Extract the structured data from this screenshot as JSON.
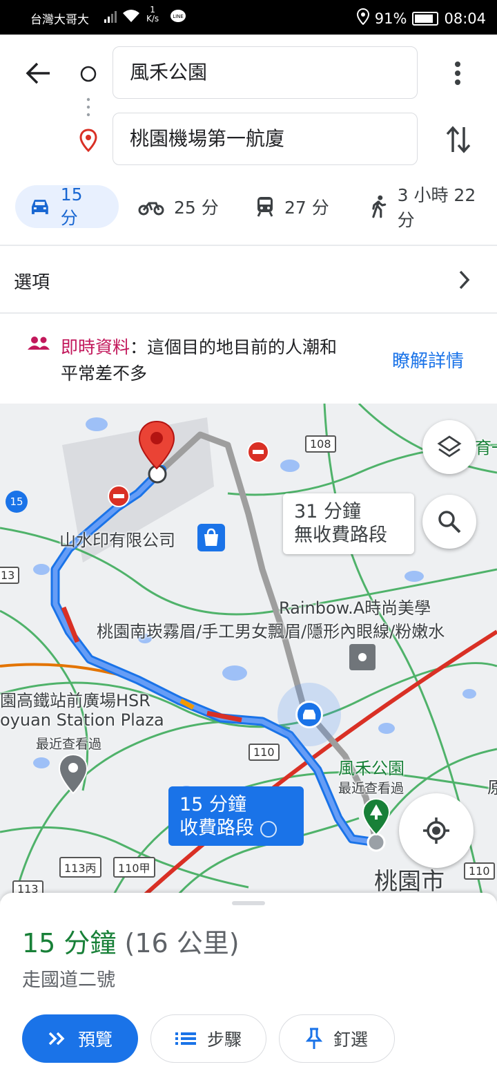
{
  "status_bar": {
    "carrier": "台灣大哥大",
    "speed_value": "1",
    "speed_unit": "K/s",
    "battery": "91%",
    "time": "08:04"
  },
  "route": {
    "origin": "風禾公園",
    "destination": "桃園機場第一航廈"
  },
  "modes": [
    {
      "label": "15 分",
      "icon": "car-icon"
    },
    {
      "label": "25 分",
      "icon": "motorcycle-icon"
    },
    {
      "label": "27 分",
      "icon": "train-icon"
    },
    {
      "label": "3 小時 22 分",
      "icon": "walk-icon"
    }
  ],
  "options_label": "選項",
  "live": {
    "title": "即時資料",
    "text_1": "：這個目的地目前的人潮和",
    "text_2": "平常差不多",
    "link": "瞭解詳情"
  },
  "map": {
    "alt_route_callout": {
      "line1": "31 分鐘",
      "line2": "無收費路段"
    },
    "main_route_callout": {
      "line1": "15 分鐘",
      "line2": "收費路段"
    },
    "labels": {
      "company": "山水印有限公司",
      "rainbow": "Rainbow.A時尚美學",
      "shop": "桃園南崁霧眉/手工男女飄眉/隱形內眼線/粉嫩水",
      "hsr_1": "園高鐵站前廣場HSR",
      "hsr_2": "oyuan Station Plaza",
      "hsr_recent": "最近查看過",
      "park": "風禾公園",
      "park_recent": "最近查看過",
      "city": "桃園市",
      "edge_right": "育一",
      "edge_right2": "原"
    },
    "shields": [
      "108",
      "15",
      "13",
      "110",
      "113丙",
      "110甲",
      "113",
      "110"
    ]
  },
  "summary": {
    "duration": "15 分鐘",
    "distance": "(16 公里)",
    "via": "走國道二號"
  },
  "actions": {
    "preview": "預覽",
    "steps": "步驟",
    "pin": "釘選"
  },
  "colors": {
    "accent": "#1a73e8",
    "route": "#4285f4",
    "alt_route": "#9e9e9e",
    "green_text": "#188038",
    "live_pink": "#c2185b"
  }
}
